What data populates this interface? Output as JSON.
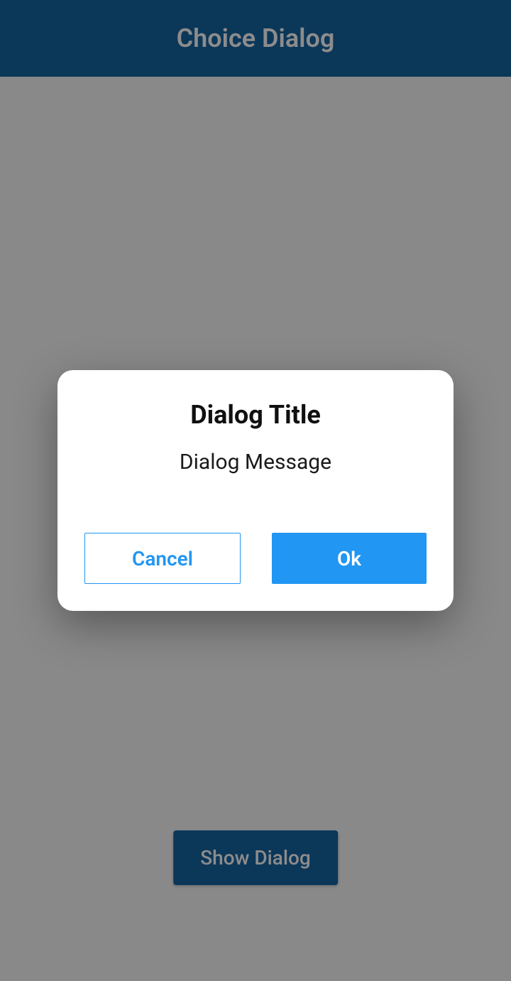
{
  "appbar": {
    "title": "Choice Dialog"
  },
  "main": {
    "show_dialog_label": "Show Dialog"
  },
  "dialog": {
    "title": "Dialog Title",
    "message": "Dialog Message",
    "cancel_label": "Cancel",
    "ok_label": "Ok"
  }
}
